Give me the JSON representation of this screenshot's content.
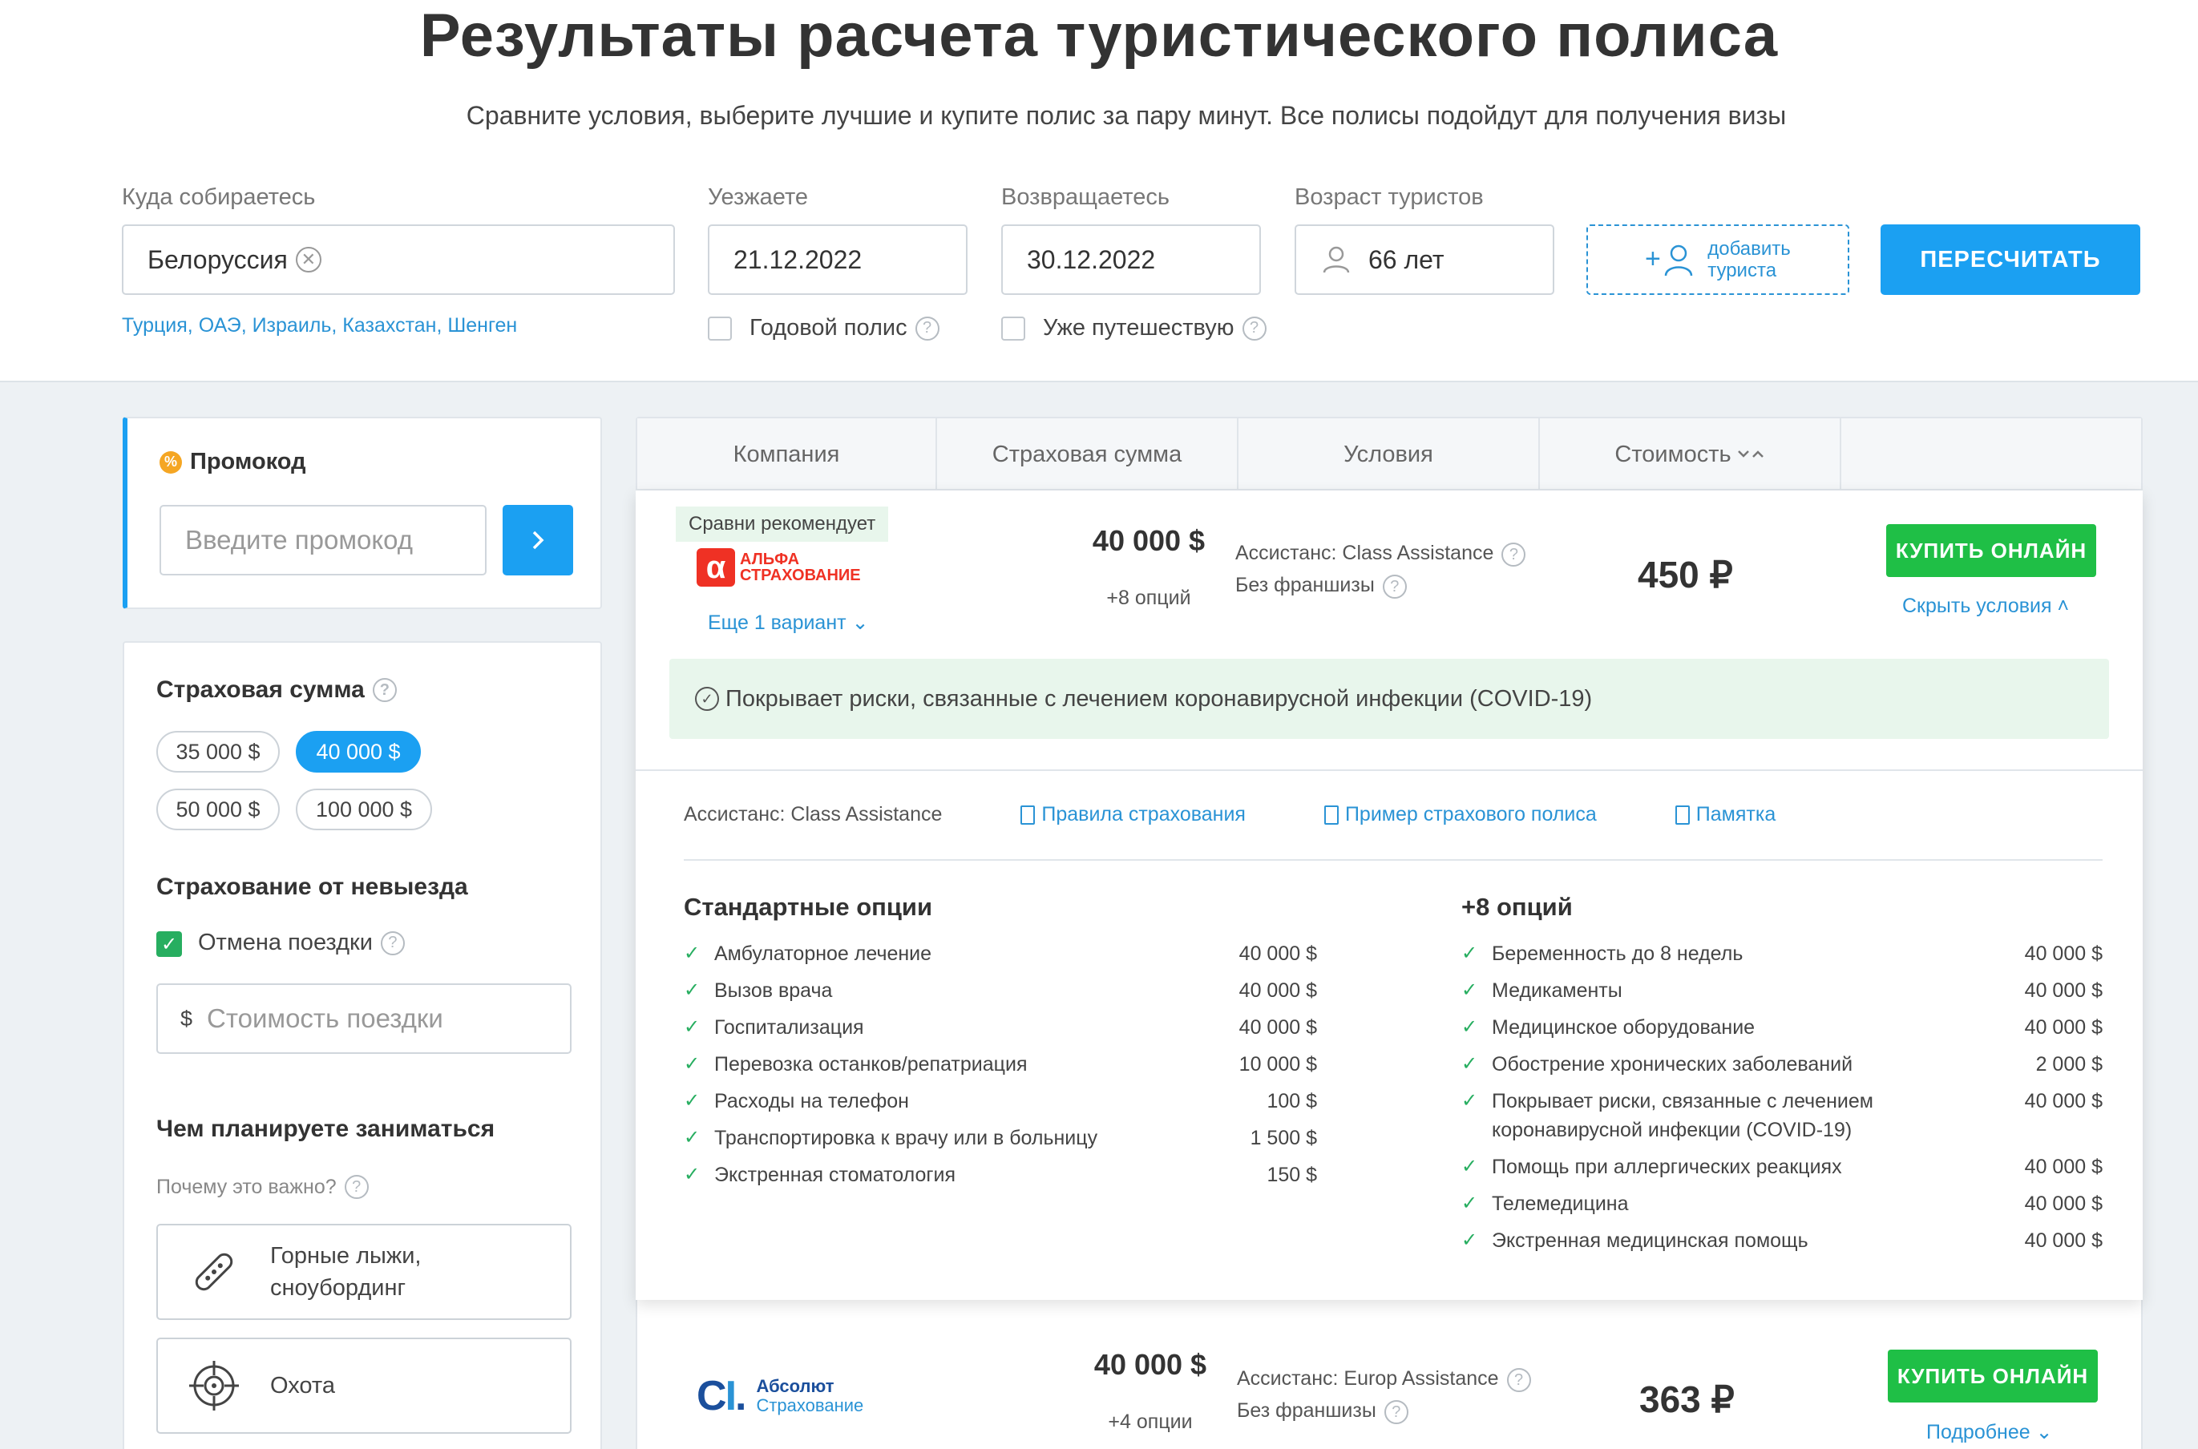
{
  "header": {
    "title": "Результаты расчета туристического полиса",
    "subtitle": "Сравните условия, выберите лучшие и купите полис за пару минут. Все полисы подойдут для получения визы"
  },
  "search": {
    "destination_label": "Куда собираетесь",
    "destination_value": "Белоруссия",
    "destination_hints": "Турция, ОАЭ, Израиль, Казахстан, Шенген",
    "depart_label": "Уезжаете",
    "depart_value": "21.12.2022",
    "return_label": "Возвращаетесь",
    "return_value": "30.12.2022",
    "age_label": "Возраст туристов",
    "age_value": "66 лет",
    "annual_policy": "Годовой полис",
    "already_travelling": "Уже путешествую",
    "add_tourist_line1": "добавить",
    "add_tourist_line2": "туриста",
    "recalc_button": "ПЕРЕСЧИТАТЬ"
  },
  "promo": {
    "title": "Промокод",
    "placeholder": "Введите промокод"
  },
  "filters": {
    "sum_title": "Страховая сумма",
    "sums": [
      "35 000 $",
      "40 000 $",
      "50 000 $",
      "100 000 $"
    ],
    "selected_sum": "40 000 $",
    "cancel_title": "Страхование от невыезда",
    "cancel_trip": "Отмена поездки",
    "cancel_trip_checked": true,
    "trip_cost_currency": "$",
    "trip_cost_placeholder": "Стоимость поездки",
    "activities_title": "Чем планируете заниматься",
    "why_important": "Почему это важно?",
    "activity_ski_line1": "Горные лыжи,",
    "activity_ski_line2": "сноубординг",
    "activity_hunt": "Охота"
  },
  "table_header": {
    "company": "Компания",
    "sum": "Страховая сумма",
    "conditions": "Условия",
    "price": "Стоимость"
  },
  "offer1": {
    "recommend": "Сравни рекомендует",
    "logo_line1": "АЛЬФА",
    "logo_line2": "СТРАХОВАНИЕ",
    "more_variants": "Еще 1 вариант",
    "sum": "40 000 $",
    "options": "+8 опций",
    "assistance": "Ассистанс: Class Assistance",
    "deductible": "Без франшизы",
    "price": "450 ₽",
    "buy": "КУПИТЬ ОНЛАЙН",
    "hide": "Скрыть условия",
    "covid": "Покрывает риски, связанные с лечением коронавирусной инфекции (COVID-19)",
    "details_assistance": "Ассистанс: Class Assistance",
    "rules_link": "Правила страхования",
    "sample_link": "Пример страхового полиса",
    "memo_link": "Памятка",
    "standard_title": "Стандартные опции",
    "standard": [
      {
        "name": "Амбулаторное лечение",
        "value": "40 000 $"
      },
      {
        "name": "Вызов врача",
        "value": "40 000 $"
      },
      {
        "name": "Госпитализация",
        "value": "40 000 $"
      },
      {
        "name": "Перевозка останков/репатриация",
        "value": "10 000 $"
      },
      {
        "name": "Расходы на телефон",
        "value": "100 $"
      },
      {
        "name": "Транспортировка к врачу или в больницу",
        "value": "1 500 $"
      },
      {
        "name": "Экстренная стоматология",
        "value": "150 $"
      }
    ],
    "extra_title": "+8 опций",
    "extra": [
      {
        "name": "Беременность до 8 недель",
        "value": "40 000 $"
      },
      {
        "name": "Медикаменты",
        "value": "40 000 $"
      },
      {
        "name": "Медицинское оборудование",
        "value": "40 000 $"
      },
      {
        "name": "Обострение хронических заболеваний",
        "value": "2 000 $"
      },
      {
        "name": "Покрывает риски, связанные с лечением коронавирусной инфекции (COVID-19)",
        "value": "40 000 $"
      },
      {
        "name": "Помощь при аллергических реакциях",
        "value": "40 000 $"
      },
      {
        "name": "Телемедицина",
        "value": "40 000 $"
      },
      {
        "name": "Экстренная медицинская помощь",
        "value": "40 000 $"
      }
    ]
  },
  "offer2": {
    "logo_line1": "Абсолют",
    "logo_line2": "Страхование",
    "sum": "40 000 $",
    "options": "+4 опции",
    "assistance": "Ассистанс: Europ Assistance",
    "deductible": "Без франшизы",
    "price": "363 ₽",
    "buy": "КУПИТЬ ОНЛАЙН",
    "more": "Подробнее"
  }
}
